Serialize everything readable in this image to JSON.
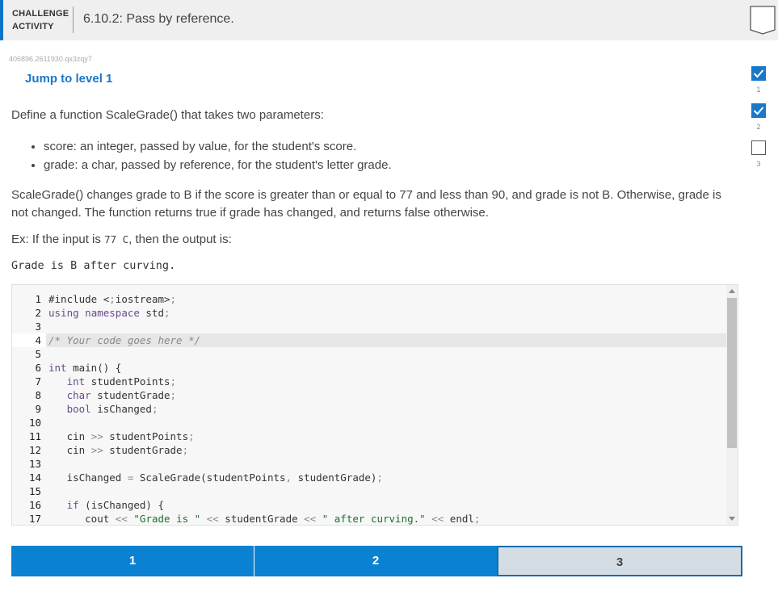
{
  "header": {
    "label_line1": "CHALLENGE",
    "label_line2": "ACTIVITY",
    "title": "6.10.2: Pass by reference."
  },
  "activity_tag": "406896.2611930.qx3zqy7",
  "jump_link": "Jump to level 1",
  "prompt": {
    "intro": "Define a function ScaleGrade() that takes two parameters:",
    "bullets": [
      "score: an integer, passed by value, for the student's score.",
      "grade: a char, passed by reference, for the student's letter grade."
    ],
    "description": "ScaleGrade() changes grade to B if the score is greater than or equal to 77 and less than 90, and grade is not B. Otherwise, grade is not changed. The function returns true if grade has changed, and returns false otherwise.",
    "example_prefix": "Ex: If the input is ",
    "example_input": "77 C",
    "example_suffix": ", then the output is:",
    "example_output": "Grade is B after curving."
  },
  "editor": {
    "line_numbers": [
      "1",
      "2",
      "3",
      "4",
      "5",
      "6",
      "7",
      "8",
      "9",
      "10",
      "11",
      "12",
      "13",
      "14",
      "15",
      "16",
      "17"
    ],
    "active_line": 4,
    "lines": [
      "#include <iostream>",
      "using namespace std;",
      "",
      "/* Your code goes here */",
      "",
      "int main() {",
      "   int studentPoints;",
      "   char studentGrade;",
      "   bool isChanged;",
      "",
      "   cin >> studentPoints;",
      "   cin >> studentGrade;",
      "",
      "   isChanged = ScaleGrade(studentPoints, studentGrade);",
      "",
      "   if (isChanged) {",
      "      cout << \"Grade is \" << studentGrade << \" after curving.\" << endl;"
    ]
  },
  "levels": [
    {
      "label": "1",
      "status": "done"
    },
    {
      "label": "2",
      "status": "done"
    },
    {
      "label": "3",
      "status": "current"
    }
  ],
  "side_progress": [
    {
      "num": "1",
      "checked": true
    },
    {
      "num": "2",
      "checked": true
    },
    {
      "num": "3",
      "checked": false
    }
  ],
  "colors": {
    "accent": "#0e75c4",
    "level_done": "#0a81d1",
    "level_current": "#d5dde4",
    "link": "#1978c8"
  }
}
